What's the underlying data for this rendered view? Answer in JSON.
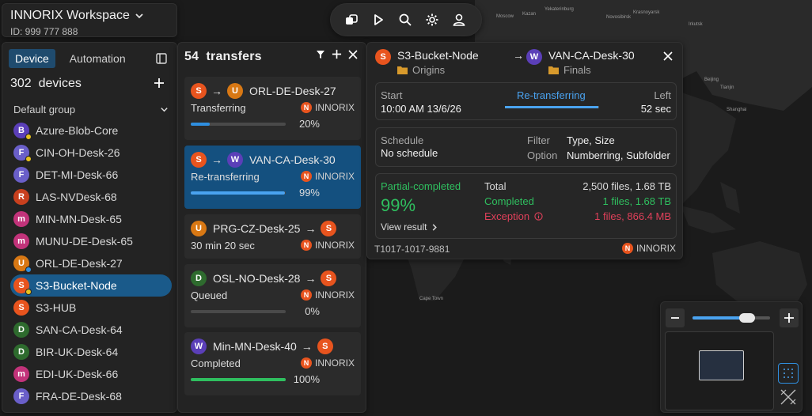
{
  "workspace": {
    "title": "INNORIX Workspace",
    "id": "ID: 999 777 888"
  },
  "map": {
    "cities": [
      {
        "name": "Moscow"
      },
      {
        "name": "Kazan"
      },
      {
        "name": "Yekaterinburg"
      },
      {
        "name": "Novosibirsk"
      },
      {
        "name": "Krasnoyarsk"
      },
      {
        "name": "Irkutsk"
      },
      {
        "name": "Beijing"
      },
      {
        "name": "Tianjin"
      },
      {
        "name": "Shanghai"
      },
      {
        "name": "Cape Town"
      }
    ]
  },
  "devicePanel": {
    "tabs": [
      "Device",
      "Automation"
    ],
    "count": "302",
    "countLabel": "devices",
    "group": "Default group",
    "devices": [
      {
        "letter": "B",
        "name": "Azure-Blob-Core",
        "color": "#5b3fb8",
        "dot": "#e8c21e"
      },
      {
        "letter": "F",
        "name": "CIN-OH-Desk-26",
        "color": "#6a5fc9",
        "dot": "#e8c21e"
      },
      {
        "letter": "F",
        "name": "DET-MI-Desk-66",
        "color": "#6a5fc9",
        "dot": ""
      },
      {
        "letter": "R",
        "name": "LAS-NVDesk-68",
        "color": "#c8401e",
        "dot": ""
      },
      {
        "letter": "m",
        "name": "MIN-MN-Desk-65",
        "color": "#c2337a",
        "dot": ""
      },
      {
        "letter": "m",
        "name": "MUNU-DE-Desk-65",
        "color": "#c2337a",
        "dot": ""
      },
      {
        "letter": "U",
        "name": "ORL-DE-Desk-27",
        "color": "#d87814",
        "dot": "#2f8fe0"
      },
      {
        "letter": "S",
        "name": "S3-Bucket-Node",
        "color": "#e8541e",
        "dot": "#e8c21e",
        "selected": true
      },
      {
        "letter": "S",
        "name": "S3-HUB",
        "color": "#e8541e",
        "dot": ""
      },
      {
        "letter": "D",
        "name": "SAN-CA-Desk-64",
        "color": "#2e6b2e",
        "dot": ""
      },
      {
        "letter": "D",
        "name": "BIR-UK-Desk-64",
        "color": "#2e6b2e",
        "dot": ""
      },
      {
        "letter": "m",
        "name": "EDI-UK-Desk-66",
        "color": "#c2337a",
        "dot": ""
      },
      {
        "letter": "F",
        "name": "FRA-DE-Desk-68",
        "color": "#6a5fc9",
        "dot": ""
      }
    ]
  },
  "transfers": {
    "count": "54",
    "label": "transfers",
    "items": [
      {
        "fromLetter": "S",
        "fromColor": "#e8541e",
        "toLetter": "U",
        "toColor": "#d87814",
        "dest": "ORL-DE-Desk-27",
        "status": "Transferring",
        "org": "INNORIX",
        "pct": "20%",
        "fill": 0.2,
        "barColor": "#2f8fe0",
        "selected": false,
        "destFirst": false
      },
      {
        "fromLetter": "S",
        "fromColor": "#e8541e",
        "toLetter": "W",
        "toColor": "#5b3fb8",
        "dest": "VAN-CA-Desk-30",
        "status": "Re-transferring",
        "org": "INNORIX",
        "pct": "99%",
        "fill": 0.99,
        "barColor": "#4aa3f0",
        "selected": true,
        "destFirst": false
      },
      {
        "fromLetter": "U",
        "fromColor": "#d87814",
        "toLetter": "S",
        "toColor": "#e8541e",
        "dest": "PRG-CZ-Desk-25",
        "status": "30 min 20 sec",
        "org": "INNORIX",
        "pct": "",
        "fill": 0,
        "barColor": "",
        "selected": false,
        "destFirst": true
      },
      {
        "fromLetter": "D",
        "fromColor": "#2e6b2e",
        "toLetter": "S",
        "toColor": "#e8541e",
        "dest": "OSL-NO-Desk-28",
        "status": "Queued",
        "org": "INNORIX",
        "pct": "0%",
        "fill": 0,
        "barColor": "#9a9a9a",
        "selected": false,
        "destFirst": true
      },
      {
        "fromLetter": "W",
        "fromColor": "#5b3fb8",
        "toLetter": "S",
        "toColor": "#e8541e",
        "dest": "Min-MN-Desk-40",
        "status": "Completed",
        "org": "INNORIX",
        "pct": "100%",
        "fill": 1,
        "barColor": "#2fbf5f",
        "selected": false,
        "destFirst": true
      }
    ]
  },
  "detail": {
    "from": {
      "letter": "S",
      "name": "S3-Bucket-Node",
      "folder": "Origins"
    },
    "to": {
      "letter": "W",
      "name": "VAN-CA-Desk-30",
      "folder": "Finals"
    },
    "startLabel": "Start",
    "startValue": "10:00 AM 13/6/26",
    "status": "Re-transferring",
    "progress": 0.99,
    "leftLabel": "Left",
    "leftValue": "52 sec",
    "scheduleLabel": "Schedule",
    "scheduleValue": "No schedule",
    "filterLabel": "Filter",
    "filterValue": "Type, Size",
    "optionLabel": "Option",
    "optionValue": "Numberring, Subfolder",
    "resultStatus": "Partial-completed",
    "resultPct": "99%",
    "viewResult": "View result",
    "totalLabel": "Total",
    "totalValue": "2,500 files, 1.68 TB",
    "completedLabel": "Completed",
    "completedValue": "1 files, 1.68 TB",
    "exceptionLabel": "Exception",
    "exceptionValue": "1 files, 866.4 MB",
    "jobId": "T1017-1017-9881",
    "org": "INNORIX"
  },
  "zoom": {
    "level": 0.7
  }
}
